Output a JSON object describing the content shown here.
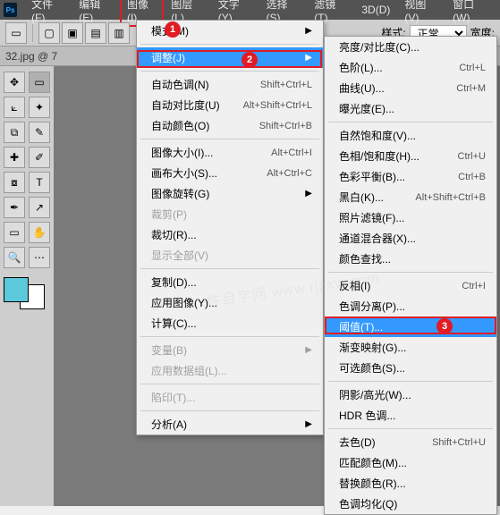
{
  "menubar": {
    "ps": "Ps",
    "items": [
      "文件(F)",
      "编辑(E)",
      "图像(I)",
      "图层(L)",
      "文字(Y)",
      "选择(S)",
      "滤镜(T)",
      "3D(D)",
      "视图(V)",
      "窗口(W)"
    ]
  },
  "toolbar": {
    "style_label": "样式:",
    "style_value": "正常",
    "width_label": "宽度:"
  },
  "tabrow": "32.jpg @ 7",
  "menu1": {
    "mode": "模式(M)",
    "adjust": "调整(J)",
    "autotone": "自动色调(N)",
    "autotone_s": "Shift+Ctrl+L",
    "autocontrast": "自动对比度(U)",
    "autocontrast_s": "Alt+Shift+Ctrl+L",
    "autocolor": "自动颜色(O)",
    "autocolor_s": "Shift+Ctrl+B",
    "imagesize": "图像大小(I)...",
    "imagesize_s": "Alt+Ctrl+I",
    "canvassize": "画布大小(S)...",
    "canvassize_s": "Alt+Ctrl+C",
    "imagerotate": "图像旋转(G)",
    "crop": "裁剪(P)",
    "trim": "裁切(R)...",
    "reveal": "显示全部(V)",
    "duplicate": "复制(D)...",
    "applyimg": "应用图像(Y)...",
    "calc": "计算(C)...",
    "variables": "变量(B)",
    "applyds": "应用数据组(L)...",
    "trap": "陷印(T)...",
    "analysis": "分析(A)"
  },
  "menu2": {
    "brightcontrast": "亮度/对比度(C)...",
    "levels": "色阶(L)...",
    "levels_s": "Ctrl+L",
    "curves": "曲线(U)...",
    "curves_s": "Ctrl+M",
    "exposure": "曝光度(E)...",
    "vibrance": "自然饱和度(V)...",
    "huesat": "色相/饱和度(H)...",
    "huesat_s": "Ctrl+U",
    "colorbal": "色彩平衡(B)...",
    "colorbal_s": "Ctrl+B",
    "bw": "黑白(K)...",
    "bw_s": "Alt+Shift+Ctrl+B",
    "photofilter": "照片滤镜(F)...",
    "channelmix": "通道混合器(X)...",
    "colorlookup": "颜色查找...",
    "invert": "反相(I)",
    "invert_s": "Ctrl+I",
    "posterize": "色调分离(P)...",
    "threshold": "阈值(T)...",
    "gradmap": "渐变映射(G)...",
    "selcolor": "可选颜色(S)...",
    "shadowhl": "阴影/高光(W)...",
    "hdr": "HDR 色调...",
    "desat": "去色(D)",
    "desat_s": "Shift+Ctrl+U",
    "matchcolor": "匹配颜色(M)...",
    "replacecolor": "替换颜色(R)...",
    "equalize": "色调均化(Q)"
  },
  "callouts": {
    "c1": "1",
    "c2": "2",
    "c3": "3"
  },
  "watermark": "件自学网 www.rjzxw.com"
}
